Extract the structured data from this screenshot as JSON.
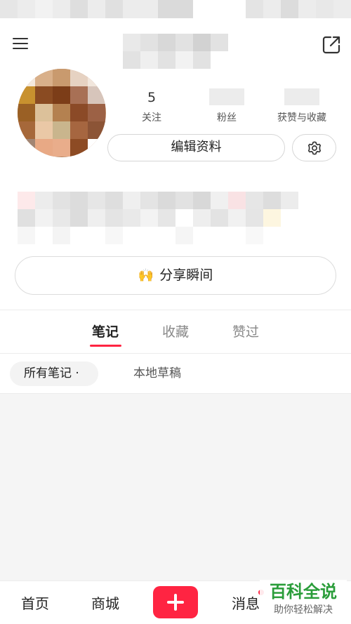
{
  "header": {
    "menu_icon": "menu-icon",
    "share_icon": "share-icon"
  },
  "profile": {
    "stats": [
      {
        "count": "5",
        "label": "关注"
      },
      {
        "count": "",
        "label": "粉丝"
      },
      {
        "count": "",
        "label": "获赞与收藏"
      }
    ],
    "edit_label": "编辑资料",
    "settings_icon": "gear-icon"
  },
  "moment": {
    "emoji": "🙌",
    "label": "分享瞬间"
  },
  "tabs": [
    {
      "label": "笔记",
      "active": true
    },
    {
      "label": "收藏",
      "active": false
    },
    {
      "label": "赞过",
      "active": false
    }
  ],
  "filters": {
    "all_notes": "所有笔记 ·",
    "local_drafts": "本地草稿"
  },
  "bottom_nav": {
    "home": "首页",
    "mall": "商城",
    "add_icon": "plus-icon",
    "messages": "消息"
  },
  "watermark": {
    "title": "百科全说",
    "subtitle": "助你轻松解决"
  },
  "colors": {
    "accent": "#ff2442",
    "watermark_green": "#2a9d3a"
  }
}
